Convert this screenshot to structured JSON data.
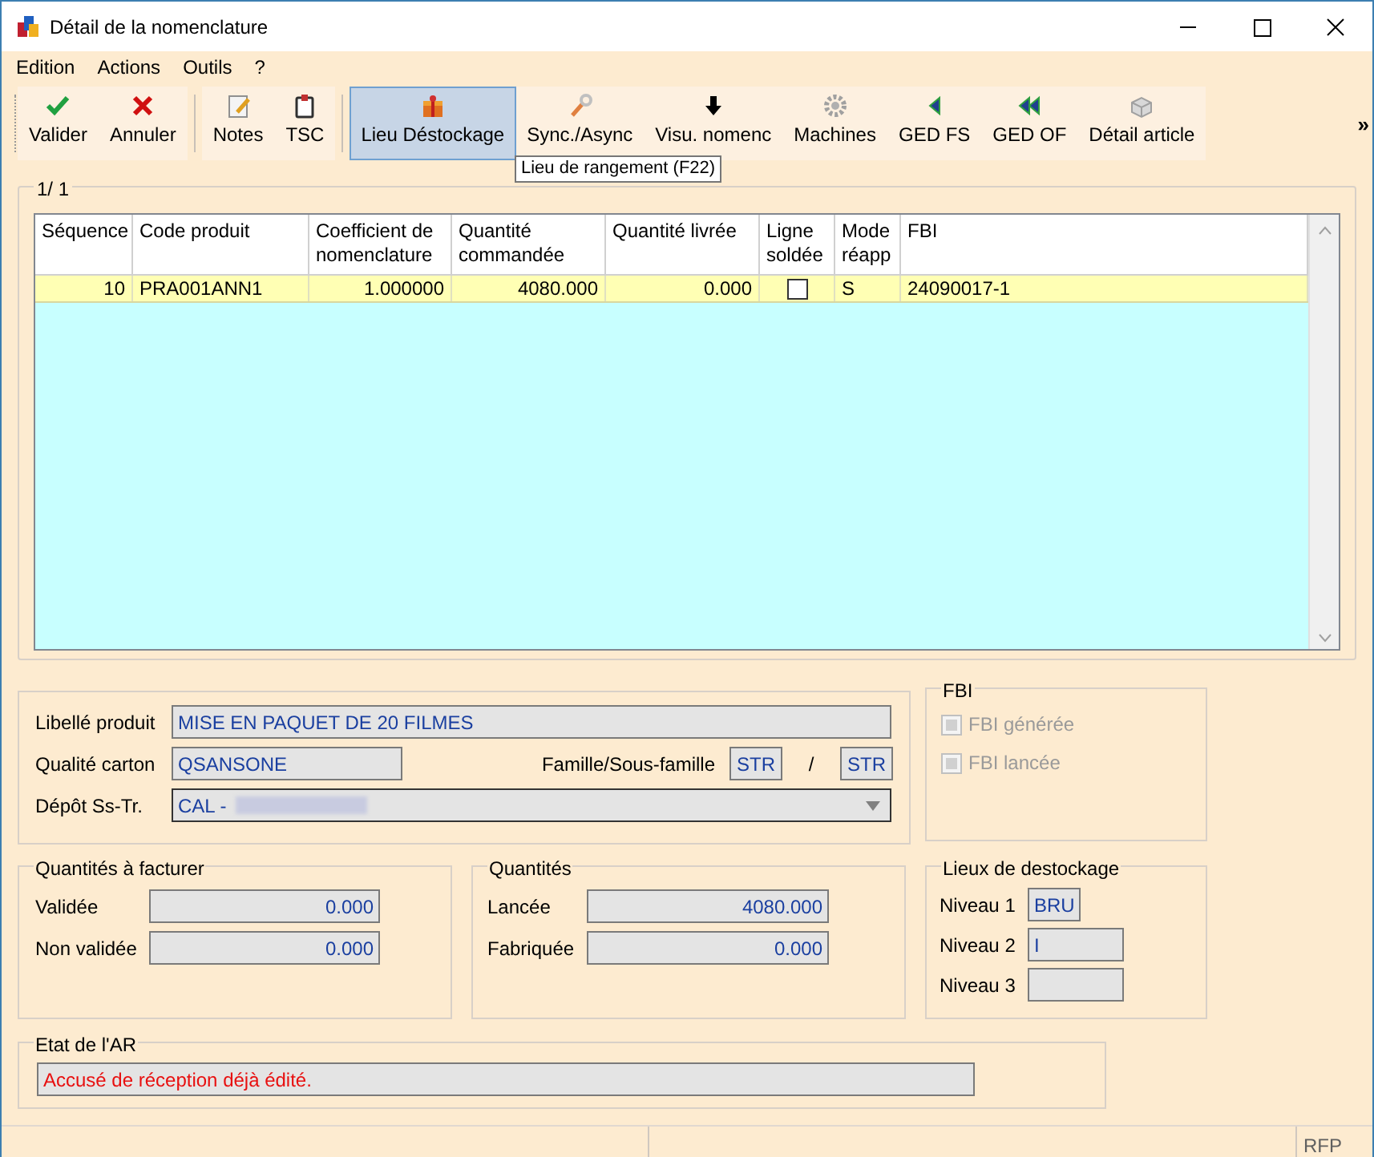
{
  "window": {
    "title": "Détail de la nomenclature"
  },
  "menu": [
    "Edition",
    "Actions",
    "Outils",
    "?"
  ],
  "toolbar": [
    {
      "label": "Valider",
      "kind": "check",
      "selected": false
    },
    {
      "label": "Annuler",
      "kind": "cross",
      "selected": false
    },
    {
      "label": "Notes",
      "kind": "notes",
      "selected": false
    },
    {
      "label": "TSC",
      "kind": "clip",
      "selected": false
    },
    {
      "label": "Lieu Déstockage",
      "kind": "box",
      "selected": true
    },
    {
      "label": "Sync./Async",
      "kind": "wrench",
      "selected": false
    },
    {
      "label": "Visu. nomenc",
      "kind": "down",
      "selected": false
    },
    {
      "label": "Machines",
      "kind": "gear",
      "selected": false
    },
    {
      "label": "GED FS",
      "kind": "left",
      "selected": false
    },
    {
      "label": "GED OF",
      "kind": "left2",
      "selected": false
    },
    {
      "label": "Détail article",
      "kind": "brick",
      "selected": false
    }
  ],
  "toolbar_more": "»",
  "tooltip": "Lieu de rangement (F22)",
  "grid": {
    "counter": "1/ 1",
    "columns": [
      "Séquence",
      "Code produit",
      "Coefficient de nomenclature",
      "Quantité commandée",
      "Quantité livrée",
      "Ligne soldée",
      "Mode réapp",
      "FBI"
    ],
    "rows": [
      {
        "selected": true,
        "checked": false,
        "cells": [
          "10",
          "PRA001ANN1",
          "1.000000",
          "4080.000",
          "0.000",
          null,
          "S",
          "24090017-1"
        ]
      }
    ]
  },
  "product": {
    "libelle_label": "Libellé produit",
    "libelle": "MISE EN PAQUET DE 20 FILMES",
    "qualite_label": "Qualité carton",
    "qualite": "QSANSONE",
    "famille_label": "Famille/Sous-famille",
    "famille": "STR",
    "separator": "/",
    "sous_famille": "STR",
    "depot_label": "Dépôt Ss-Tr.",
    "depot": "CAL -"
  },
  "fbi": {
    "title": "FBI",
    "items": [
      {
        "label": "FBI générée",
        "checked": false,
        "disabled": true
      },
      {
        "label": "FBI lancée",
        "checked": false,
        "disabled": true
      }
    ]
  },
  "facturer": {
    "title": "Quantités à facturer",
    "fields": [
      {
        "label": "Validée",
        "value": "0.000"
      },
      {
        "label": "Non validée",
        "value": "0.000"
      }
    ]
  },
  "quantites": {
    "title": "Quantités",
    "fields": [
      {
        "label": "Lancée",
        "value": "4080.000"
      },
      {
        "label": "Fabriquée",
        "value": "0.000"
      }
    ]
  },
  "lieux": {
    "title": "Lieux de destockage",
    "fields": [
      {
        "label": "Niveau 1",
        "value": "BRU"
      },
      {
        "label": "Niveau 2",
        "value": "I"
      },
      {
        "label": "Niveau 3"
      }
    ]
  },
  "etat": {
    "title": "Etat de l'AR",
    "value": "Accusé de réception déjà édité."
  },
  "status_bar": {
    "right": "RFP"
  }
}
